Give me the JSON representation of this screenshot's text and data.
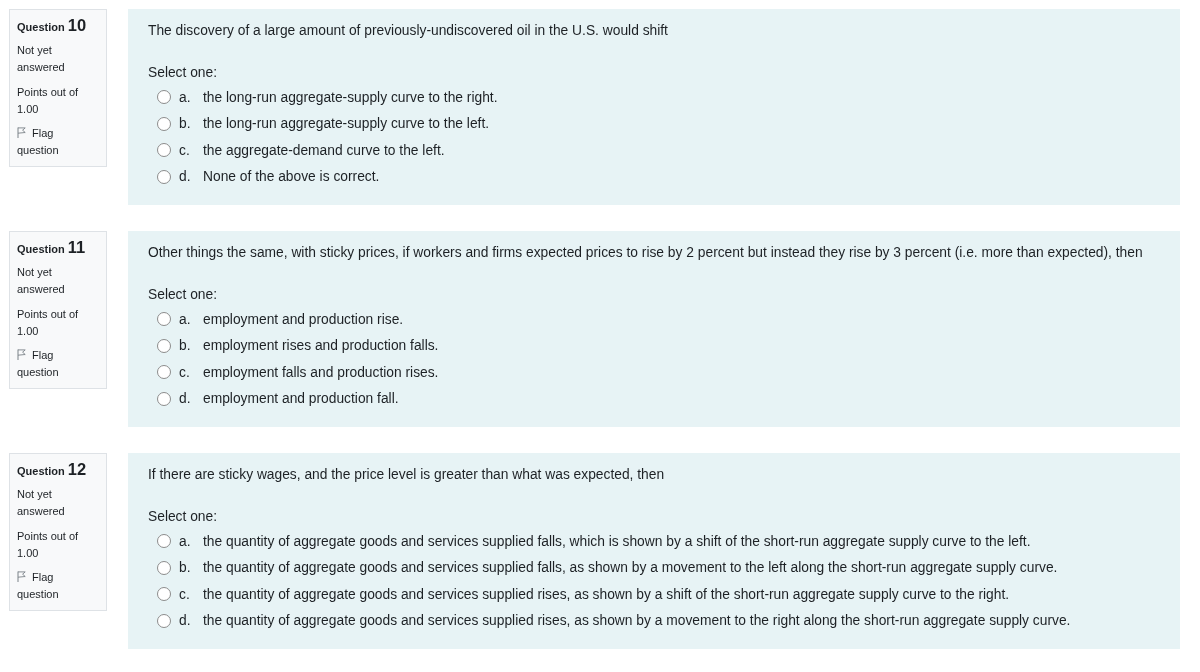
{
  "questions": [
    {
      "label": "Question",
      "number": "10",
      "status": "Not yet answered",
      "points": "Points out of 1.00",
      "flag": {
        "label": "Flag question",
        "flagged": false
      },
      "text": "The discovery of a large amount of previously-undiscovered oil in the U.S. would shift",
      "prompt": "Select one:",
      "options": [
        {
          "letter": "a.",
          "text": "the long-run aggregate-supply curve to the right.",
          "selected": false
        },
        {
          "letter": "b.",
          "text": "the long-run aggregate-supply curve to the left.",
          "selected": false
        },
        {
          "letter": "c.",
          "text": "the aggregate-demand curve to the left.",
          "selected": false
        },
        {
          "letter": "d.",
          "text": "None of the above is correct.",
          "selected": false
        }
      ]
    },
    {
      "label": "Question",
      "number": "11",
      "status": "Not yet answered",
      "points": "Points out of 1.00",
      "flag": {
        "label": "Flag question",
        "flagged": false
      },
      "text": "Other things the same, with sticky prices, if workers and firms expected prices to rise by 2 percent but instead they rise by 3 percent (i.e. more than expected), then",
      "prompt": "Select one:",
      "options": [
        {
          "letter": "a.",
          "text": "employment and production rise.",
          "selected": false
        },
        {
          "letter": "b.",
          "text": "employment rises and production falls.",
          "selected": false
        },
        {
          "letter": "c.",
          "text": "employment falls and production rises.",
          "selected": false
        },
        {
          "letter": "d.",
          "text": "employment and production fall.",
          "selected": false
        }
      ]
    },
    {
      "label": "Question",
      "number": "12",
      "status": "Not yet answered",
      "points": "Points out of 1.00",
      "flag": {
        "label": "Flag question",
        "flagged": false
      },
      "text": "If there are sticky wages, and the price level is greater than what was expected, then",
      "prompt": "Select one:",
      "options": [
        {
          "letter": "a.",
          "text": "the quantity of aggregate goods and services supplied falls, which is shown by a shift of the short-run aggregate supply curve to the left.",
          "selected": false
        },
        {
          "letter": "b.",
          "text": "the quantity of aggregate goods and services supplied falls, as shown by a movement to the left along the short-run aggregate supply curve.",
          "selected": false
        },
        {
          "letter": "c.",
          "text": "the quantity of aggregate goods and services supplied rises, as shown by a shift of the short-run aggregate supply curve to the right.",
          "selected": false
        },
        {
          "letter": "d.",
          "text": "the quantity of aggregate goods and services supplied rises, as shown by a movement to the right along the short-run aggregate supply curve.",
          "selected": false
        }
      ]
    }
  ]
}
